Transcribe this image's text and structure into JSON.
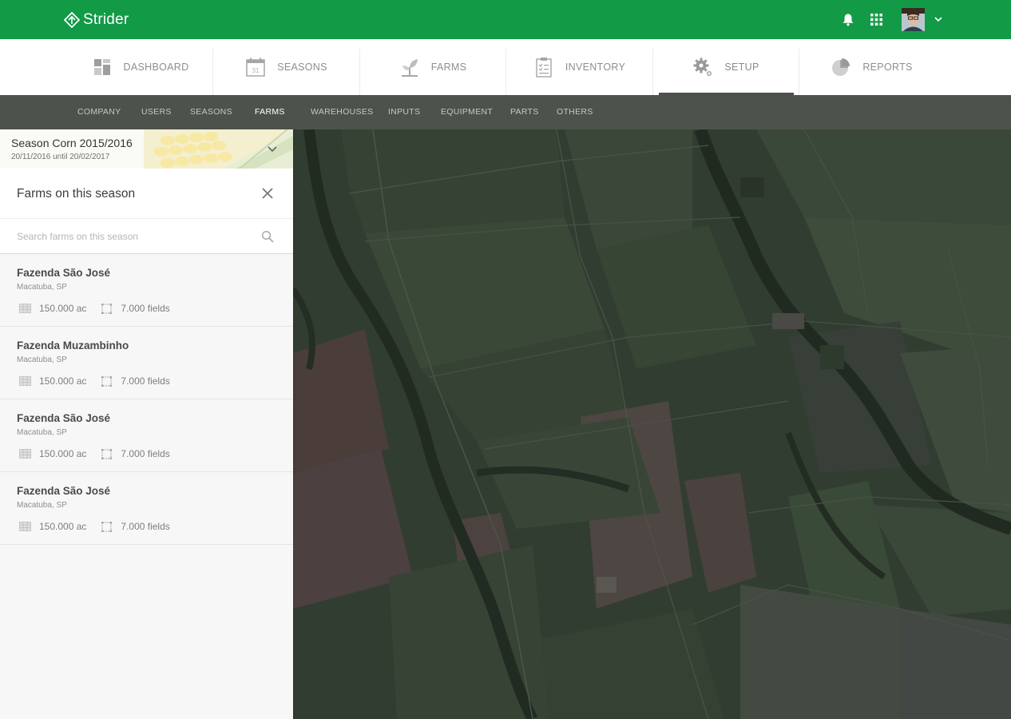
{
  "app": {
    "brand": "Strider"
  },
  "main_nav": [
    {
      "label": "DASHBOARD",
      "icon": "dashboard-icon"
    },
    {
      "label": "SEASONS",
      "icon": "calendar-icon",
      "icon_text": "31"
    },
    {
      "label": "FARMS",
      "icon": "sprout-icon"
    },
    {
      "label": "INVENTORY",
      "icon": "clipboard-icon"
    },
    {
      "label": "SETUP",
      "icon": "gear-icon",
      "active": true
    },
    {
      "label": "REPORTS",
      "icon": "pie-chart-icon"
    }
  ],
  "sub_nav": [
    {
      "label": "COMPANY"
    },
    {
      "label": "USERS"
    },
    {
      "label": "SEASONS"
    },
    {
      "label": "FARMS",
      "active": true
    },
    {
      "label": "WAREHOUSES"
    },
    {
      "label": "INPUTS"
    },
    {
      "label": "EQUIPMENT"
    },
    {
      "label": "PARTS"
    },
    {
      "label": "OTHERS"
    }
  ],
  "season": {
    "title": "Season Corn 2015/2016",
    "dates": "20/11/2016 until 20/02/2017"
  },
  "panel": {
    "title": "Farms on this season",
    "search_placeholder": "Search farms on this season"
  },
  "farms": [
    {
      "name": "Fazenda São José",
      "location": "Macatuba, SP",
      "area": "150.000 ac",
      "fields": "7.000 fields"
    },
    {
      "name": "Fazenda Muzambinho",
      "location": "Macatuba, SP",
      "area": "150.000 ac",
      "fields": "7.000 fields"
    },
    {
      "name": "Fazenda São José",
      "location": "Macatuba, SP",
      "area": "150.000 ac",
      "fields": "7.000 fields"
    },
    {
      "name": "Fazenda São José",
      "location": "Macatuba, SP",
      "area": "150.000 ac",
      "fields": "7.000 fields"
    }
  ],
  "colors": {
    "brand_green": "#129a47",
    "subnav_bg": "#4d534c",
    "map_dark": "#2f3a2f"
  }
}
